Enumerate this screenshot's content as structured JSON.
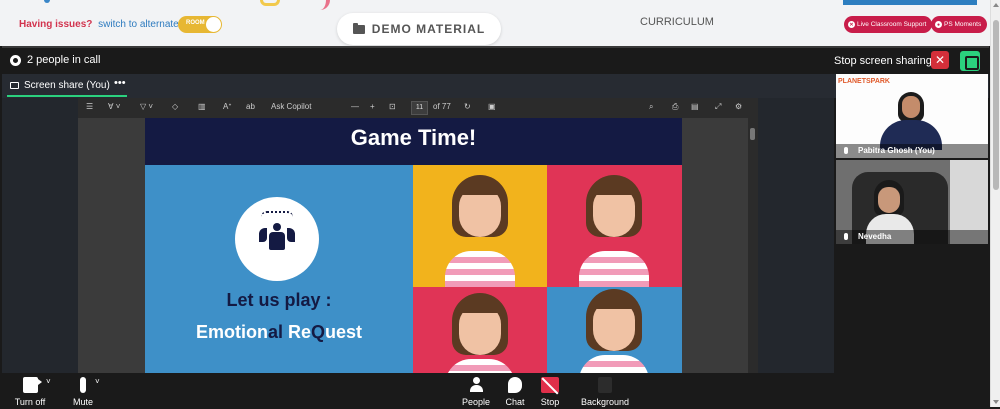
{
  "top": {
    "issues_text": "Having issues?",
    "alternate_room": "switch to alternate room",
    "room_toggle": "ROOM",
    "demo_material": "DEMO MATERIAL",
    "curriculum": "CURRICULUM",
    "live_support": "Live Classroom Support",
    "ps_moments": "PS Moments"
  },
  "call": {
    "people_in_call": "2 people in call",
    "stop_sharing": "Stop screen sharing",
    "share_tab": "Screen share (You)",
    "more": "•••"
  },
  "pdf_toolbar": {
    "ask_copilot": "Ask Copilot",
    "current_page": "11",
    "total_pages": "of 77"
  },
  "slide": {
    "title": "Game Time!",
    "lets_play": "Let us play :",
    "emotional_a": "Emotion",
    "emotional_b": "al",
    "emotional_c": " Re",
    "emotional_d": "Q",
    "emotional_e": "uest"
  },
  "participants": [
    {
      "name": "Pabitra Ghosh (You)",
      "brand": "PLANETSPARK"
    },
    {
      "name": "Nevedha"
    }
  ],
  "controls": {
    "turn_off": "Turn off",
    "mute": "Mute",
    "people": "People",
    "chat": "Chat",
    "stop": "Stop",
    "background": "Background"
  }
}
